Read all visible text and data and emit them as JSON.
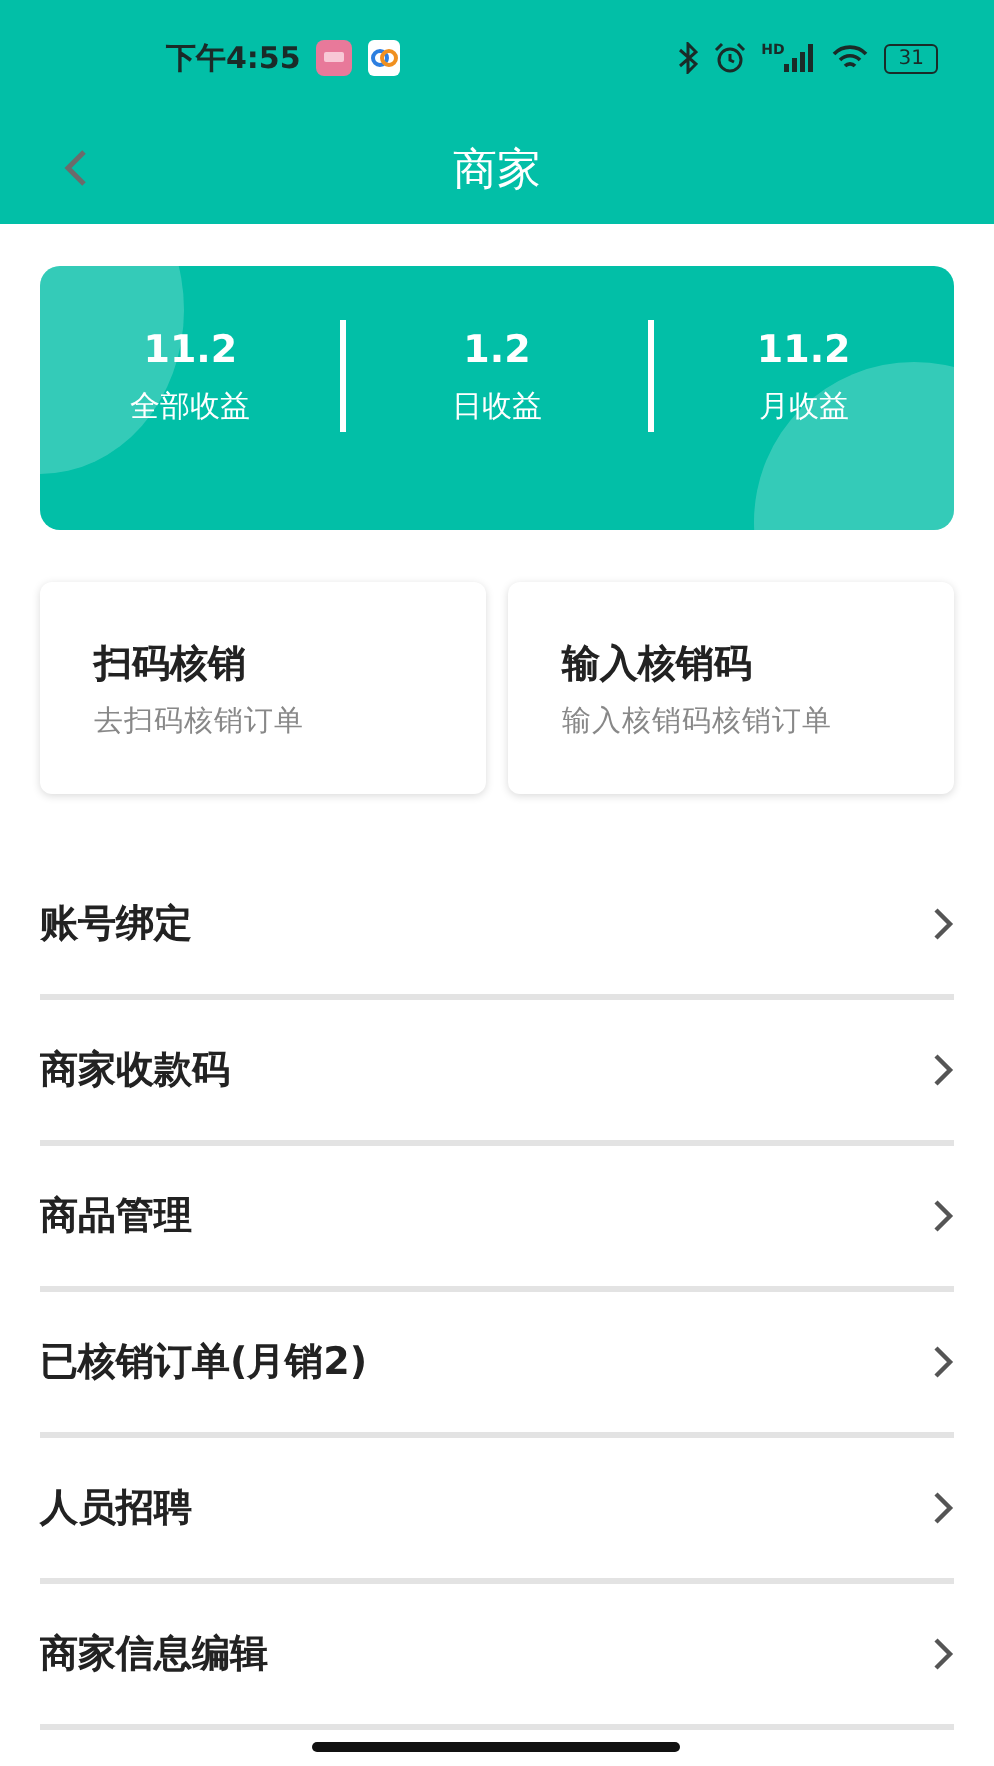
{
  "status_bar": {
    "time": "下午4:55",
    "network_label": "HD",
    "battery": "31"
  },
  "header": {
    "title": "商家"
  },
  "earnings": [
    {
      "value": "11.2",
      "label": "全部收益"
    },
    {
      "value": "1.2",
      "label": "日收益"
    },
    {
      "value": "11.2",
      "label": "月收益"
    }
  ],
  "actions": [
    {
      "title": "扫码核销",
      "subtitle": "去扫码核销订单"
    },
    {
      "title": "输入核销码",
      "subtitle": "输入核销码核销订单"
    }
  ],
  "menu": [
    {
      "label": "账号绑定"
    },
    {
      "label": "商家收款码"
    },
    {
      "label": "商品管理"
    },
    {
      "label": "已核销订单(月销2)"
    },
    {
      "label": "人员招聘"
    },
    {
      "label": "商家信息编辑"
    }
  ]
}
